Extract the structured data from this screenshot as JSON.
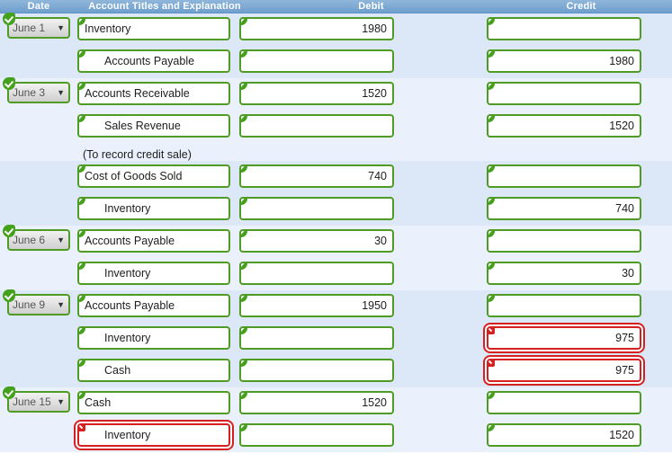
{
  "header": {
    "date": "Date",
    "account": "Account Titles and Explanation",
    "debit": "Debit",
    "credit": "Credit"
  },
  "colors": {
    "header_bg": "#7aa7d2",
    "band_a": "#dce7f7",
    "band_b": "#eaf1fc",
    "valid_border": "#4f9c25",
    "error_border": "#d62020",
    "valid_badge": "#44a11c",
    "error_badge": "#d62020"
  },
  "caret": "▼",
  "rows": [
    {
      "band": "a",
      "date": "June 1",
      "date_status": "ok",
      "account": "Inventory",
      "account_status": "ok",
      "indent": false,
      "debit": "1980",
      "debit_status": "ok",
      "credit": "",
      "credit_status": "ok"
    },
    {
      "band": "a",
      "date": "",
      "date_status": "",
      "account": "Accounts Payable",
      "account_status": "ok",
      "indent": true,
      "debit": "",
      "debit_status": "ok",
      "credit": "1980",
      "credit_status": "ok"
    },
    {
      "band": "b",
      "date": "June 3",
      "date_status": "ok",
      "account": "Accounts Receivable",
      "account_status": "ok",
      "indent": false,
      "debit": "1520",
      "debit_status": "ok",
      "credit": "",
      "credit_status": "ok"
    },
    {
      "band": "b",
      "date": "",
      "date_status": "",
      "account": "Sales Revenue",
      "account_status": "ok",
      "indent": true,
      "debit": "",
      "debit_status": "ok",
      "credit": "1520",
      "credit_status": "ok"
    },
    {
      "band": "b",
      "note": "(To record credit sale)"
    },
    {
      "band": "a",
      "date": "",
      "date_status": "",
      "account": "Cost of Goods Sold",
      "account_status": "ok",
      "indent": false,
      "debit": "740",
      "debit_status": "ok",
      "credit": "",
      "credit_status": "ok"
    },
    {
      "band": "a",
      "date": "",
      "date_status": "",
      "account": "Inventory",
      "account_status": "ok",
      "indent": true,
      "debit": "",
      "debit_status": "ok",
      "credit": "740",
      "credit_status": "ok"
    },
    {
      "band": "b",
      "date": "June 6",
      "date_status": "ok",
      "account": "Accounts Payable",
      "account_status": "ok",
      "indent": false,
      "debit": "30",
      "debit_status": "ok",
      "credit": "",
      "credit_status": "ok"
    },
    {
      "band": "b",
      "date": "",
      "date_status": "",
      "account": "Inventory",
      "account_status": "ok",
      "indent": true,
      "debit": "",
      "debit_status": "ok",
      "credit": "30",
      "credit_status": "ok"
    },
    {
      "band": "a",
      "date": "June 9",
      "date_status": "ok",
      "account": "Accounts Payable",
      "account_status": "ok",
      "indent": false,
      "debit": "1950",
      "debit_status": "ok",
      "credit": "",
      "credit_status": "ok"
    },
    {
      "band": "a",
      "date": "",
      "date_status": "",
      "account": "Inventory",
      "account_status": "ok",
      "indent": true,
      "debit": "",
      "debit_status": "ok",
      "credit": "975",
      "credit_status": "err"
    },
    {
      "band": "a",
      "date": "",
      "date_status": "",
      "account": "Cash",
      "account_status": "ok",
      "indent": true,
      "debit": "",
      "debit_status": "ok",
      "credit": "975",
      "credit_status": "err"
    },
    {
      "band": "b",
      "date": "June 15",
      "date_status": "ok",
      "account": "Cash",
      "account_status": "ok",
      "indent": false,
      "debit": "1520",
      "debit_status": "ok",
      "credit": "",
      "credit_status": "ok"
    },
    {
      "band": "b",
      "date": "",
      "date_status": "",
      "account": "Inventory",
      "account_status": "err",
      "indent": true,
      "debit": "",
      "debit_status": "ok",
      "credit": "1520",
      "credit_status": "ok"
    }
  ]
}
